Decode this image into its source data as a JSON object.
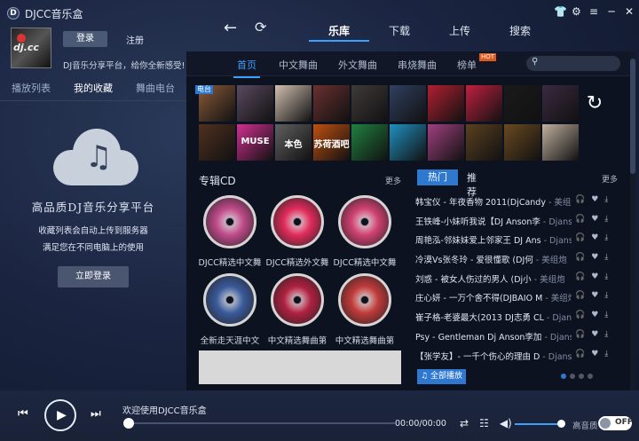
{
  "app": {
    "title": "DJCC音乐盒",
    "logo_letter": "D"
  },
  "window_controls": [
    "👕",
    "⚙",
    "≡",
    "─",
    "✕"
  ],
  "user": {
    "avatar_text": "dj.cc",
    "login_label": "登录",
    "register_label": "注册",
    "slogan": "DJ音乐分享平台，给你全新感受!"
  },
  "left_tabs": [
    "播放列表",
    "我的收藏",
    "舞曲电台"
  ],
  "left_active_tab": 1,
  "cloud_panel": {
    "title": "高品质DJ音乐分享平台",
    "desc1": "收藏列表会自动上传到服务器",
    "desc2": "满足您在不同电脑上的使用",
    "button": "立即登录"
  },
  "nav": {
    "back_icon": "←",
    "refresh_icon": "⟳",
    "tabs": [
      "乐库",
      "下载",
      "上传",
      "搜索"
    ],
    "active": 0
  },
  "subtabs": {
    "items": [
      "首页",
      "中文舞曲",
      "外文舞曲",
      "串烧舞曲",
      "榜单"
    ],
    "hot_badge": "HOT",
    "search_icon": "search-icon"
  },
  "radio_label": "电台",
  "tile_colors": [
    [
      "#8a5a3a",
      "#5a4a60",
      "#d0c0b0",
      "#6a3030",
      "#403a3a",
      "#304060",
      "#b02030",
      "#c02040",
      "#1a1a1a",
      "#3a2a40"
    ],
    [
      "#503020",
      "#d03090",
      "#606060",
      "#c05010",
      "#208040",
      "#2090c0",
      "#a04080",
      "#5a4020",
      "#6a4a20",
      "#c0b0a0"
    ]
  ],
  "tile_texts": [
    [
      "",
      "",
      "",
      "",
      "",
      "",
      "",
      "",
      "",
      ""
    ],
    [
      "",
      "MUSE",
      "本色",
      "苏荷酒吧",
      "",
      "",
      "",
      "",
      "",
      ""
    ]
  ],
  "cd_section": {
    "title": "专辑CD",
    "more": "更多",
    "items": [
      {
        "label": "DJCC精选中文舞",
        "color": "#c04a8a"
      },
      {
        "label": "DJCC精选外文舞",
        "color": "#e02a5a"
      },
      {
        "label": "DJCC精选中文舞",
        "color": "#d04070"
      },
      {
        "label": "全新走天涯中文",
        "color": "#3a5a9a"
      },
      {
        "label": "中文精选舞曲第",
        "color": "#b02040"
      },
      {
        "label": "中文精选舞曲第",
        "color": "#c03a3a"
      }
    ]
  },
  "hot_section": {
    "active_tab": "热门",
    "other_tab": "推荐",
    "more": "更多",
    "icons": [
      "🎧",
      "♥",
      "⤓"
    ],
    "songs": [
      {
        "title": "韩宝仪 - 年夜香物 2011(DjCandy",
        "artist": " - 美组炮"
      },
      {
        "title": "王铁峰-小妹听我说【DJ Anson李",
        "artist": " - Djanson李"
      },
      {
        "title": "周艳泓-邻妹妹爱上邻家王 DJ Ans",
        "artist": " - Djanson李"
      },
      {
        "title": "冷漠Vs张冬玲 - 爱很懂歌 (DJ何",
        "artist": " - 美组炮"
      },
      {
        "title": "刘惑 - 被女人伤过的男人 (Dj小",
        "artist": " - 美组炮"
      },
      {
        "title": "庄心妍 - 一万个舍不得(DJBAIO M",
        "artist": " - 美组炮"
      },
      {
        "title": "崔子格-老婆最大(2013 DJ志勇 CL",
        "artist": " - Djanson李"
      },
      {
        "title": "Psy - Gentleman Dj Anson李加",
        "artist": " - Djanson李加"
      },
      {
        "title": "【张学友】- 一千个伤心的理由 D",
        "artist": " - Djanson李加"
      }
    ],
    "play_all": "全部播放"
  },
  "player": {
    "prev_icon": "⏮",
    "play_icon": "▶",
    "next_icon": "⏭",
    "welcome": "欢迎使用DJCC音乐盒",
    "time": "00:00/00:00",
    "hq_label": "高音质",
    "toggle": "OFF"
  }
}
